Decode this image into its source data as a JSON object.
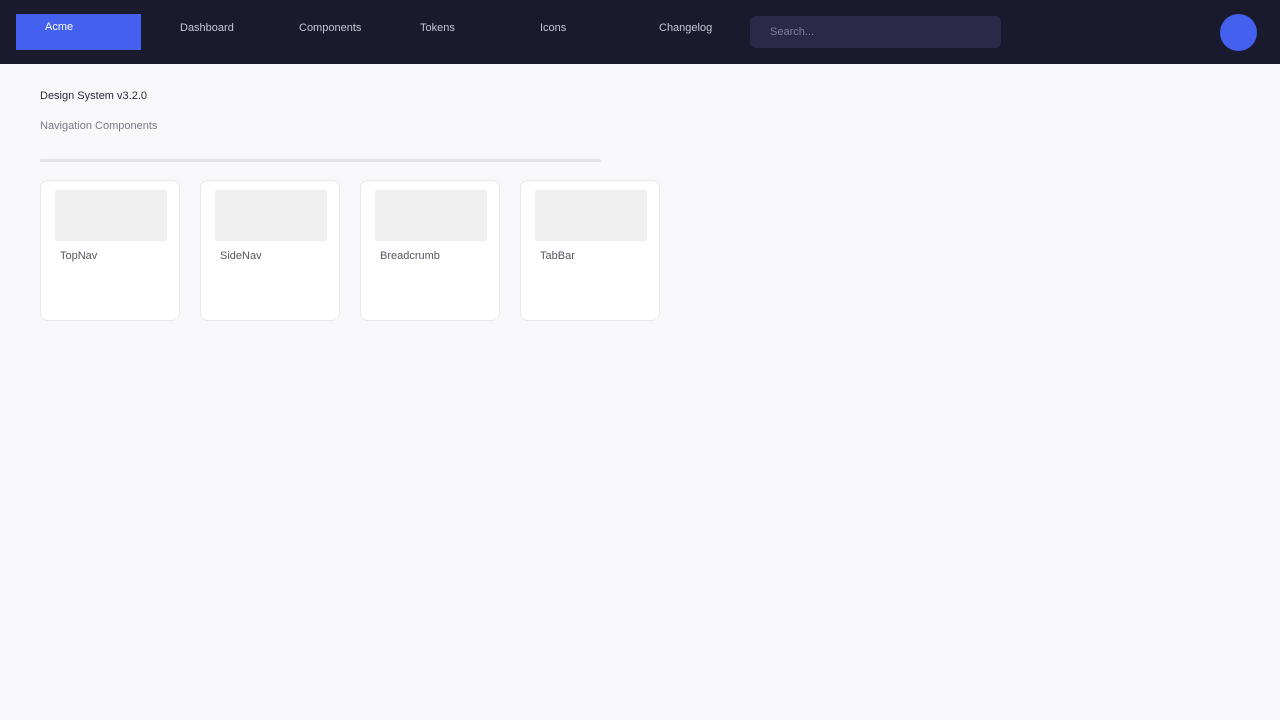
{
  "header": {
    "brand": "Acme",
    "nav": [
      "Dashboard",
      "Components",
      "Tokens",
      "Icons",
      "Changelog"
    ],
    "search_placeholder": "Search..."
  },
  "main": {
    "page_title": "Design System v3.2.0",
    "section_title": "Navigation Components",
    "cards": [
      {
        "label": "TopNav"
      },
      {
        "label": "SideNav"
      },
      {
        "label": "Breadcrumb"
      },
      {
        "label": "TabBar"
      }
    ]
  },
  "colors": {
    "topbar": "#1a1a2e",
    "accent": "#4361ee",
    "page_bg": "#f8f8fa"
  }
}
